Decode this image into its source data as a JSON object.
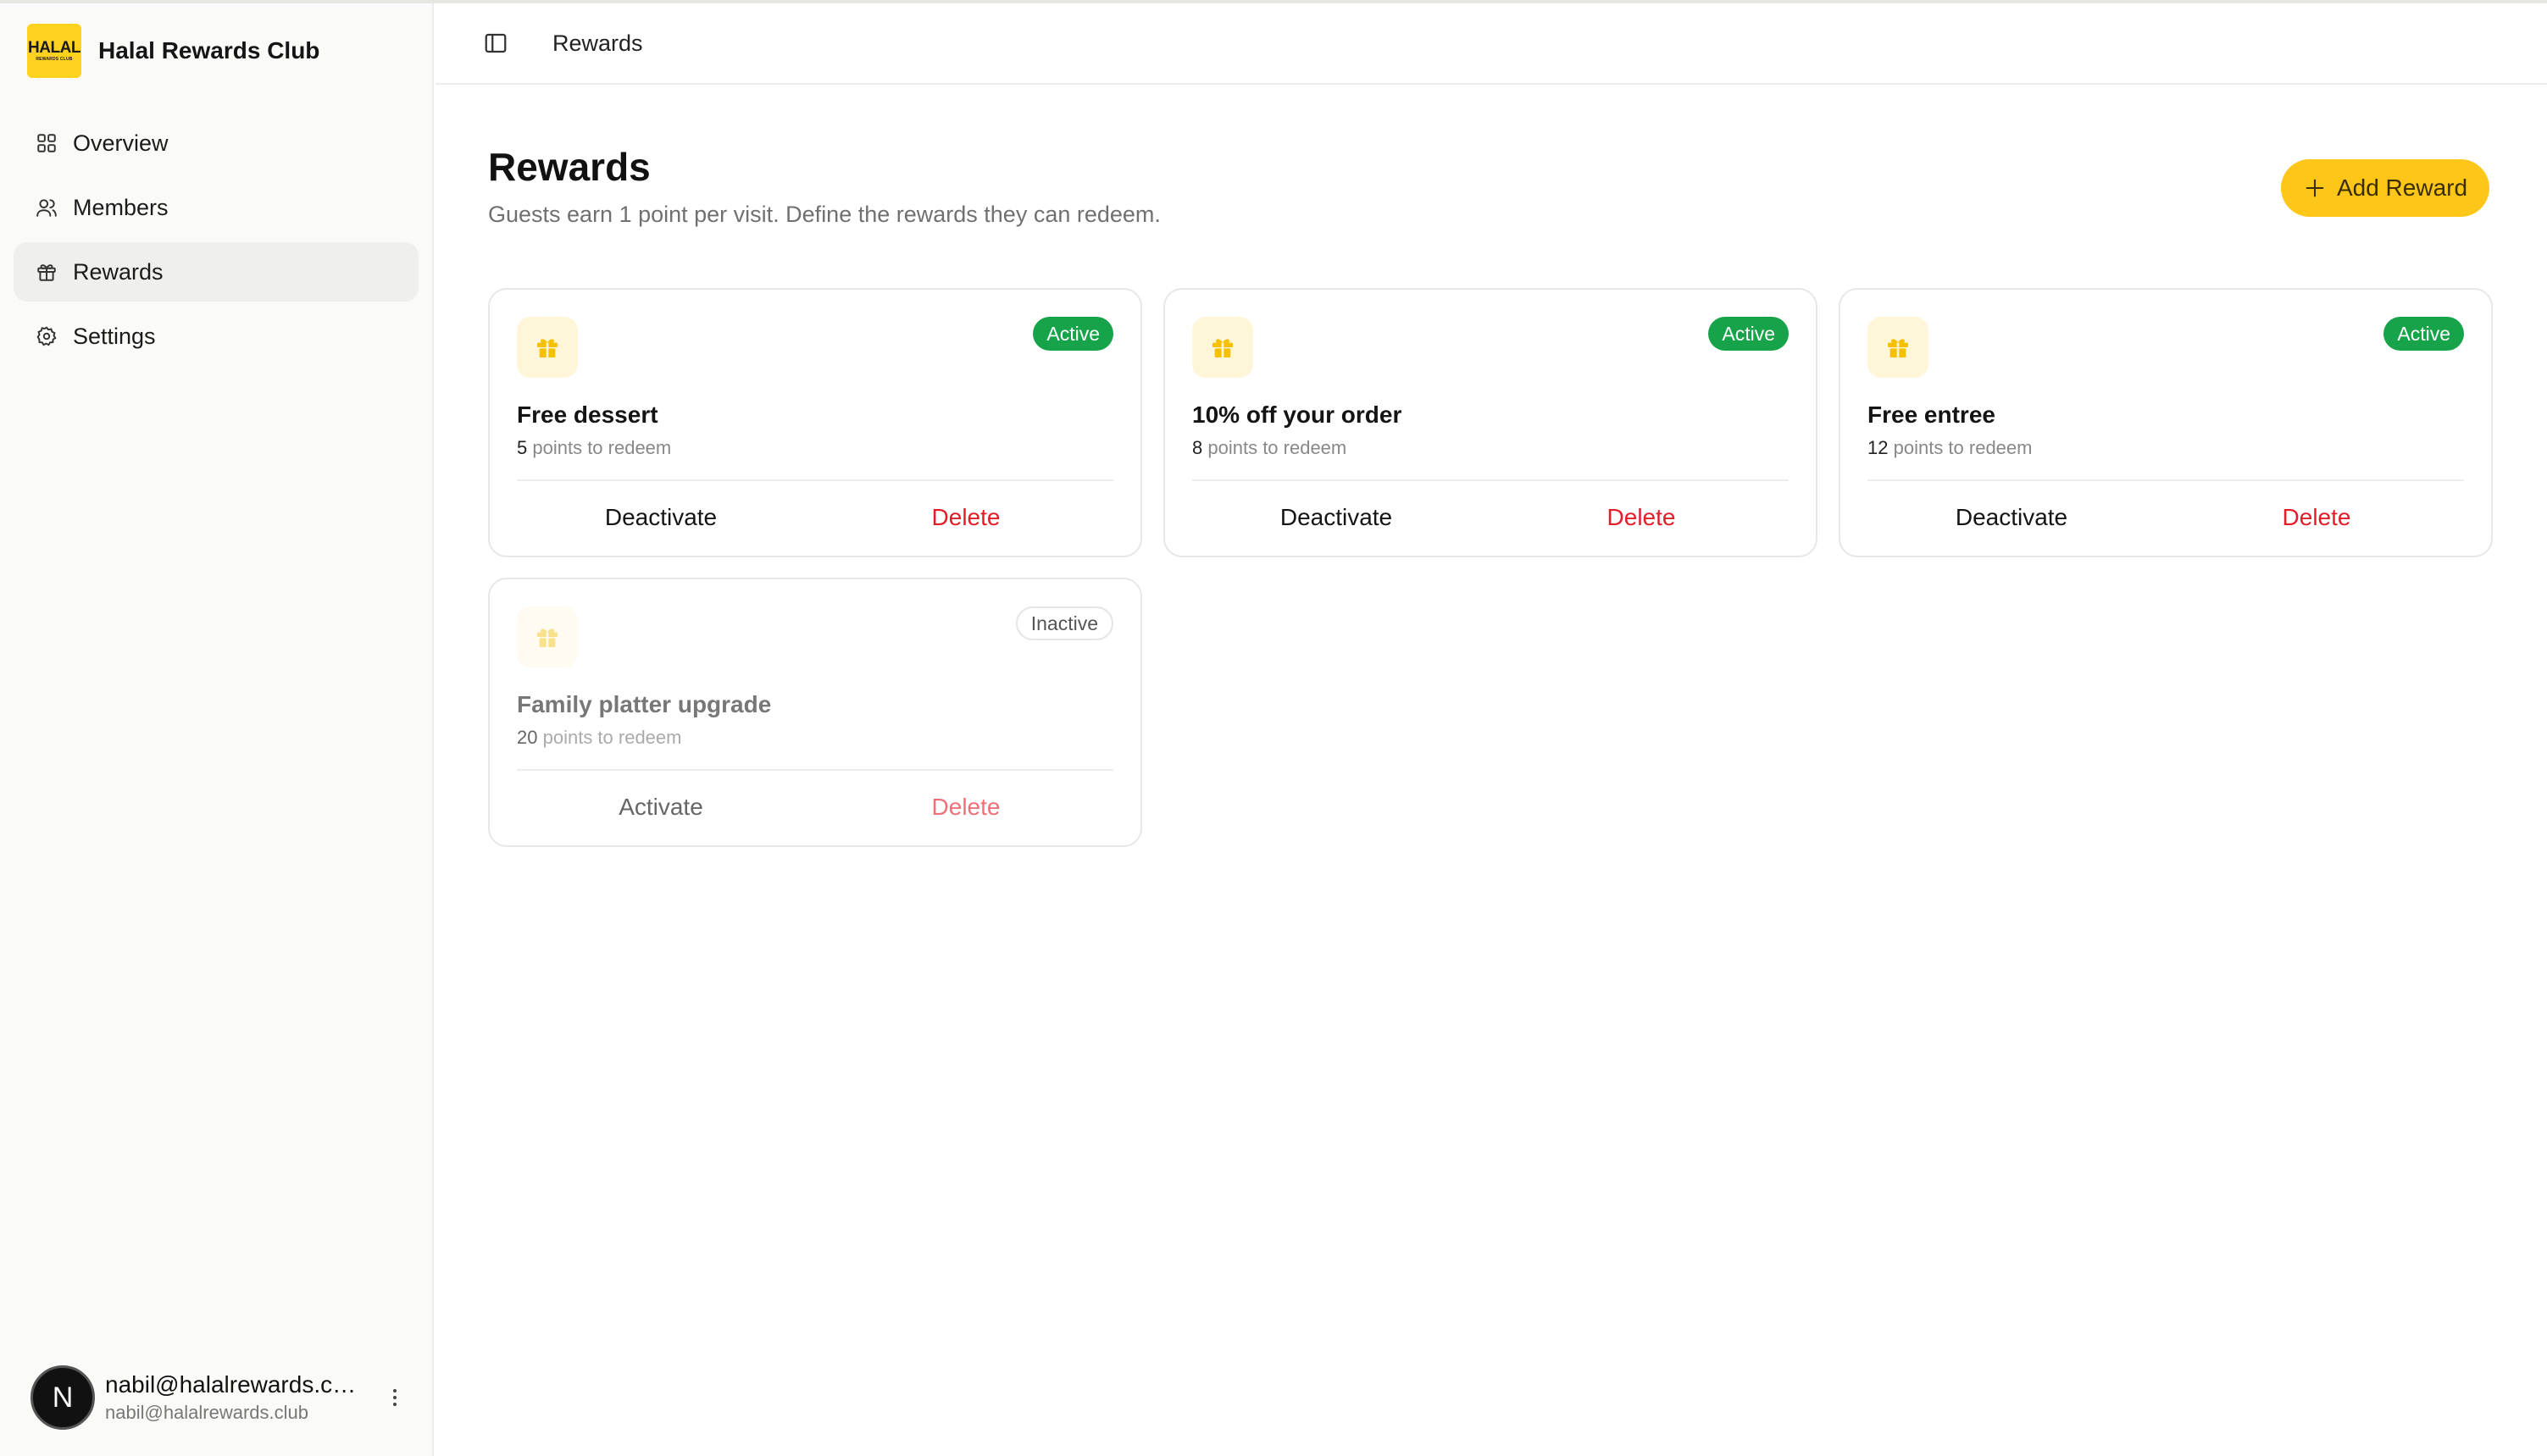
{
  "app": {
    "brand_name": "Halal Rewards Club",
    "logo_line1": "HALAL",
    "logo_line2": "REWARDS CLUB"
  },
  "sidebar": {
    "items": [
      {
        "label": "Overview",
        "icon": "grid-icon",
        "active": false
      },
      {
        "label": "Members",
        "icon": "users-icon",
        "active": false
      },
      {
        "label": "Rewards",
        "icon": "gift-icon",
        "active": true
      },
      {
        "label": "Settings",
        "icon": "gear-icon",
        "active": false
      }
    ]
  },
  "user": {
    "avatar_letter": "N",
    "name": "nabil@halalrewards.club",
    "email": "nabil@halalrewards.club"
  },
  "header": {
    "breadcrumb": "Rewards"
  },
  "main": {
    "title": "Rewards",
    "subtitle": "Guests earn 1 point per visit. Define the rewards they can redeem.",
    "add_button_label": "Add Reward"
  },
  "rewards": [
    {
      "name": "Free dessert",
      "points": "5",
      "points_suffix": "points to redeem",
      "status": "Active",
      "action": "Deactivate",
      "delete": "Delete"
    },
    {
      "name": "10% off your order",
      "points": "8",
      "points_suffix": "points to redeem",
      "status": "Active",
      "action": "Deactivate",
      "delete": "Delete"
    },
    {
      "name": "Free entree",
      "points": "12",
      "points_suffix": "points to redeem",
      "status": "Active",
      "action": "Deactivate",
      "delete": "Delete"
    },
    {
      "name": "Family platter upgrade",
      "points": "20",
      "points_suffix": "points to redeem",
      "status": "Inactive",
      "action": "Activate",
      "delete": "Delete"
    }
  ],
  "colors": {
    "accent": "#ffc61a",
    "active_badge": "#16a34a",
    "delete": "#e11d2a"
  }
}
